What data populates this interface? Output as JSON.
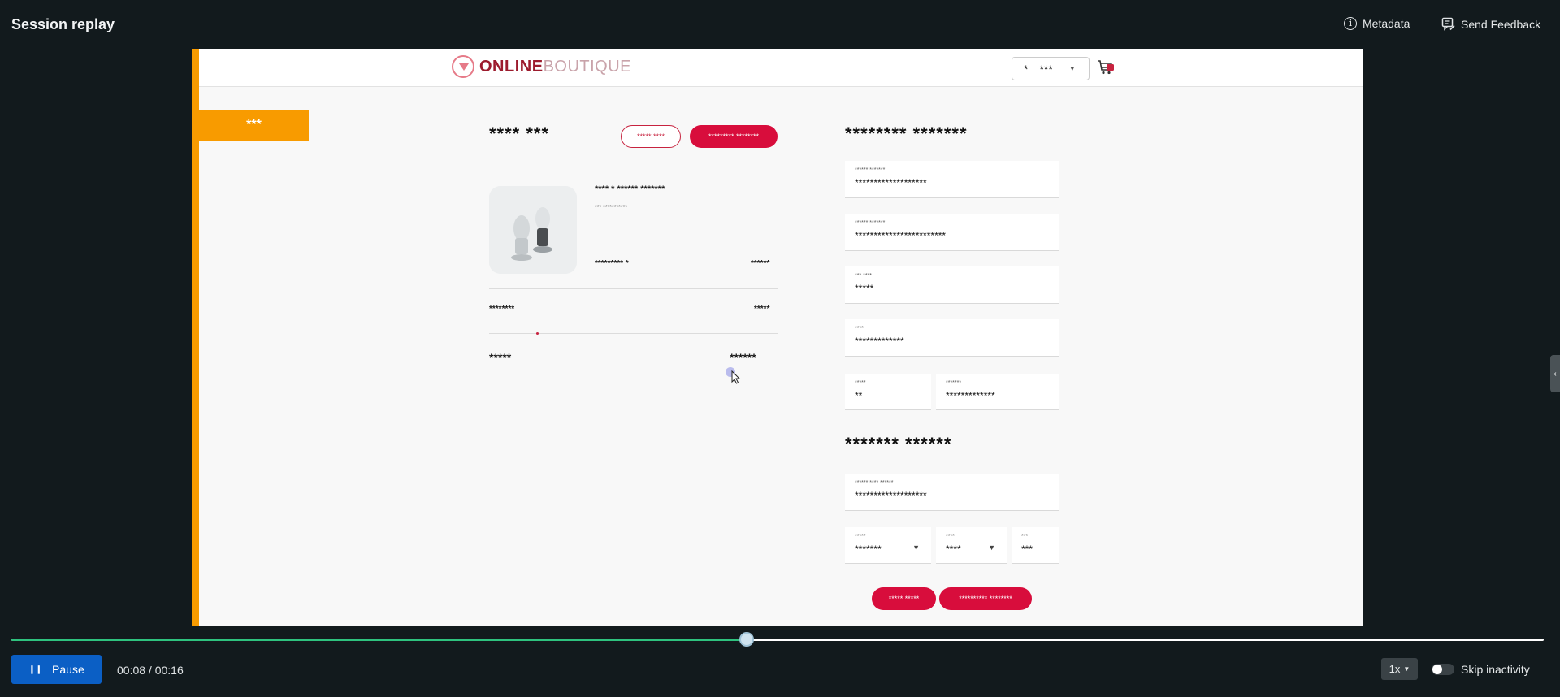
{
  "header": {
    "title": "Session replay",
    "metadata_label": "Metadata",
    "feedback_label": "Send Feedback"
  },
  "shop": {
    "logo_bold": "ONLINE",
    "logo_light": "BOUTIQUE",
    "currency_symbol": "*",
    "currency_code": "***",
    "orange_tag": "***",
    "cart": {
      "title": "**** ***",
      "empty_button": "***** ****",
      "continue_button": "********* ********",
      "product_name": "**** * ****** *******",
      "product_sku": "*** ***********",
      "product_qty": "********* *",
      "product_price": "******",
      "shipping_label": "********",
      "shipping_value": "*****",
      "total_label": "*****",
      "total_value": "******"
    },
    "shipping": {
      "title": "******** *******",
      "fields": [
        {
          "label": "****** *******",
          "value": "*******************"
        },
        {
          "label": "****** *******",
          "value": "************************"
        },
        {
          "label": "*** ****",
          "value": "*****"
        },
        {
          "label": "****",
          "value": "*************"
        },
        {
          "label": "*****",
          "value": "**"
        },
        {
          "label": "*******",
          "value": "*************"
        }
      ]
    },
    "payment": {
      "title": "******* ******",
      "card_label": "****** **** ******",
      "card_value": "*******************",
      "month_label": "*****",
      "month_value": "*******",
      "year_label": "****",
      "year_value": "****",
      "cvv_label": "***",
      "cvv_value": "***",
      "cancel_button": "***** *****",
      "place_order_button": "********** ********"
    }
  },
  "player": {
    "pause_label": "Pause",
    "time": "00:08 / 00:16",
    "progress_fraction": 0.4796,
    "speed": "1x",
    "skip_inactivity_label": "Skip inactivity",
    "skip_inactivity_on": false,
    "accent": "#2ec27e"
  }
}
